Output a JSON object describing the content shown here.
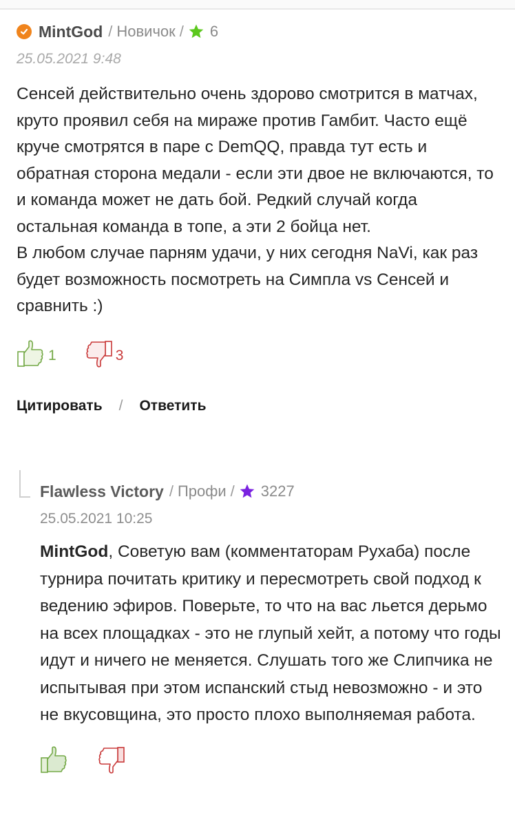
{
  "comments": [
    {
      "author": "MintGod",
      "separator": "/",
      "rank": "Новичок",
      "points": "6",
      "date": "25.05.2021 9:48",
      "paragraphs": [
        "Сенсей действительно очень здорово смотрится в матчах, круто проявил себя на мираже против Гамбит. Часто ещё круче смотрятся в паре с DemQQ, правда тут есть и обратная сторона медали - если эти двое не включаются, то и команда может не дать бой. Редкий случай когда остальная команда в топе, а эти 2 бойца нет.",
        "В любом случае парням удачи, у них сегодня NaVi, как раз будет возможность посмотреть на Симпла vs Сенсей и сравнить :)"
      ],
      "likes": "1",
      "dislikes": "3",
      "quote_label": "Цитировать",
      "reply_label": "Ответить",
      "actions_separator": "/",
      "star_color": "#5cc81e",
      "avatar_color": "#f0841c"
    },
    {
      "author": "Flawless Victory",
      "separator": "/",
      "rank": "Профи",
      "points": "3227",
      "date": "25.05.2021 10:25",
      "mention": "MintGod",
      "text": ", Советую вам (комментаторам Рухаба) после турнира почитать критику и пересмотреть свой подход к ведению эфиров. Поверьте, то что на вас льется дерьмо на всех площадках - это не глупый хейт, а потому что годы идут и ничего не меняется. Слушать того же Слипчика не испытывая при этом испанский стыд невозможно - и это не вкусовщина, это просто плохо выполняемая работа.",
      "star_color": "#7a22e0"
    }
  ],
  "colors": {
    "like": "#74a947",
    "dislike": "#c93a3a"
  },
  "icons": {
    "like": "thumbs-up-icon",
    "dislike": "thumbs-down-icon",
    "star": "star-icon",
    "user": "user-badge-icon"
  }
}
